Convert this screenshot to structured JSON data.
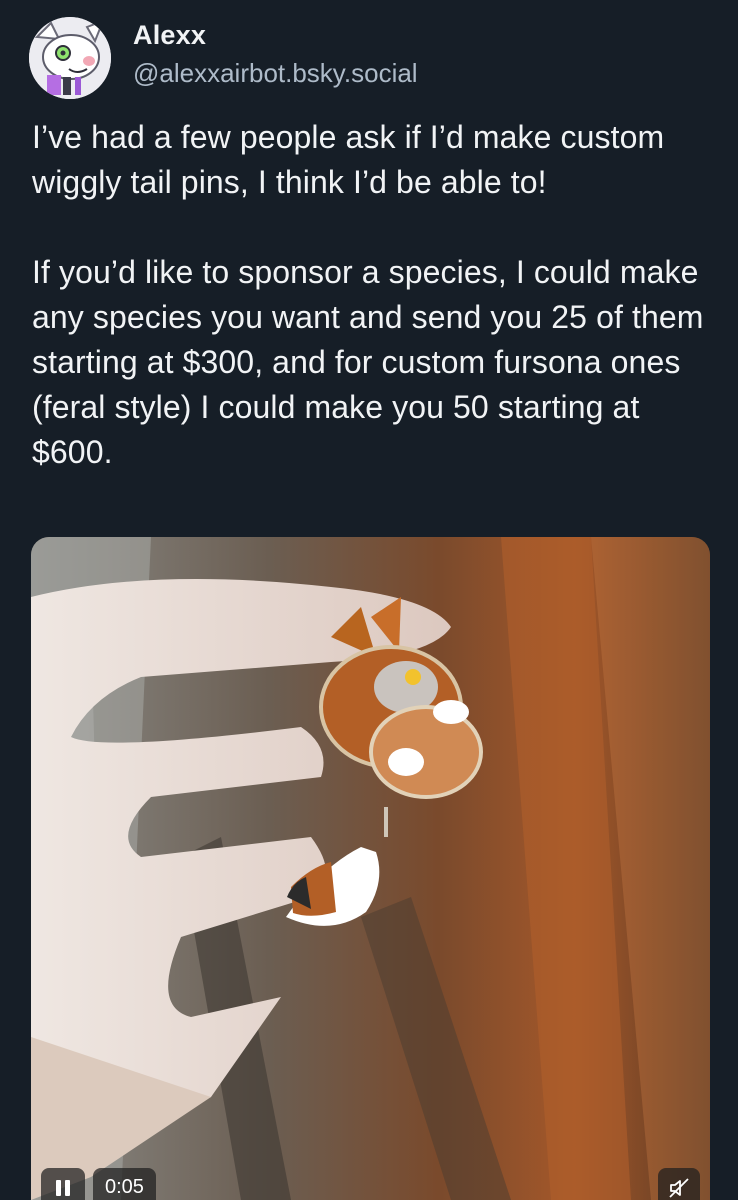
{
  "post": {
    "author": {
      "display_name": "Alexx",
      "handle": "@alexxairbot.bsky.social",
      "avatar_icon": "avatar-icon"
    },
    "paragraphs": [
      "I’ve had a few people ask if I’d make custom wiggly tail pins, I think I’d be able to!",
      "If you’d like to sponsor a species, I could make any species you want and send you 25 of them starting at $300, and for custom fursona ones (feral style) I could make you 50 starting at $600."
    ],
    "video": {
      "timestamp": "0:05",
      "pause_icon": "pause-icon",
      "mute_icon": "muted-speaker-icon"
    }
  },
  "colors": {
    "background": "#161e27",
    "text": "#f1f3f5",
    "handle": "#aebbc9"
  }
}
